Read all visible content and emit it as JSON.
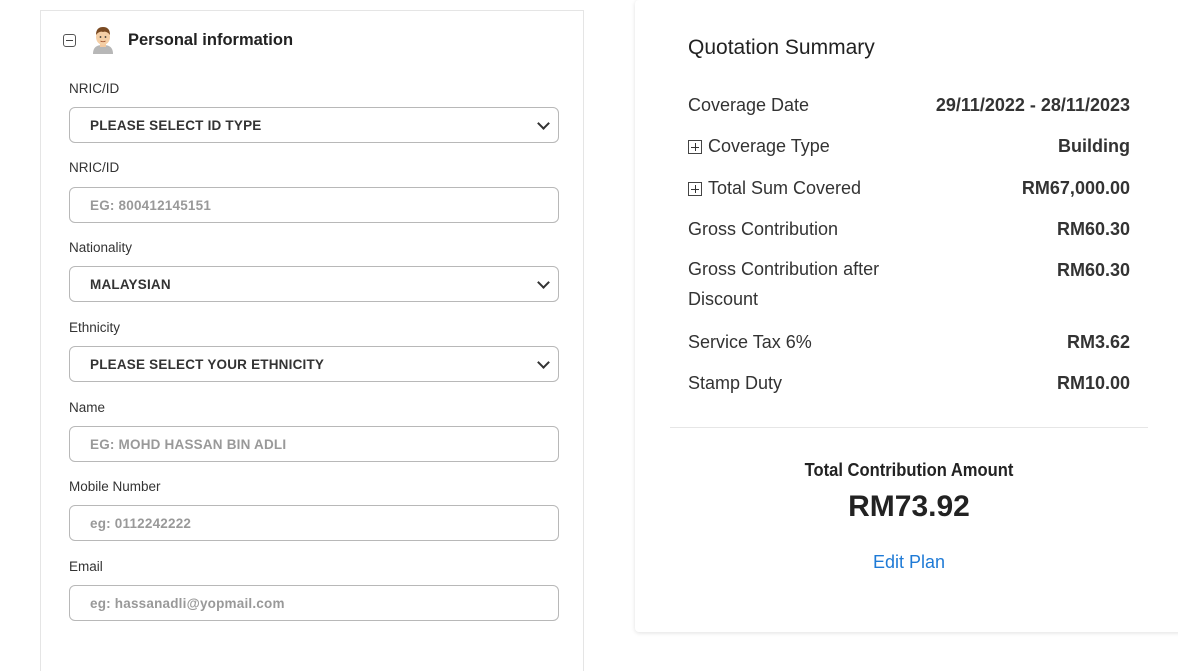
{
  "personal_section": {
    "title": "Personal information",
    "fields": {
      "id_type": {
        "label": "NRIC/ID",
        "value": "PLEASE SELECT ID TYPE"
      },
      "id_number": {
        "label": "NRIC/ID",
        "placeholder": "EG: 800412145151"
      },
      "nationality": {
        "label": "Nationality",
        "value": "MALAYSIAN"
      },
      "ethnicity": {
        "label": "Ethnicity",
        "value": "PLEASE SELECT YOUR ETHNICITY"
      },
      "name": {
        "label": "Name",
        "placeholder": "EG: MOHD HASSAN BIN ADLI"
      },
      "mobile": {
        "label": "Mobile Number",
        "placeholder": "eg: 0112242222"
      },
      "email": {
        "label": "Email",
        "placeholder": "eg: hassanadli@yopmail.com"
      }
    }
  },
  "summary": {
    "title": "Quotation Summary",
    "rows": [
      {
        "label": "Coverage Date",
        "value": "29/11/2022 - 28/11/2023"
      },
      {
        "label": "Coverage Type",
        "value": "Building"
      },
      {
        "label": "Total Sum Covered",
        "value": "RM67,000.00"
      },
      {
        "label": "Gross Contribution",
        "value": "RM60.30"
      },
      {
        "label": "Gross Contribution after",
        "label2": "Discount",
        "value": "RM60.30"
      },
      {
        "label": "Service Tax 6%",
        "value": "RM3.62"
      },
      {
        "label": "Stamp Duty",
        "value": "RM10.00"
      }
    ],
    "total_label": "Total Contribution Amount",
    "total_amount": "RM73.92",
    "edit_plan": "Edit Plan"
  },
  "colors": {
    "link": "#1e7ad6",
    "border": "#b8b8b8"
  }
}
